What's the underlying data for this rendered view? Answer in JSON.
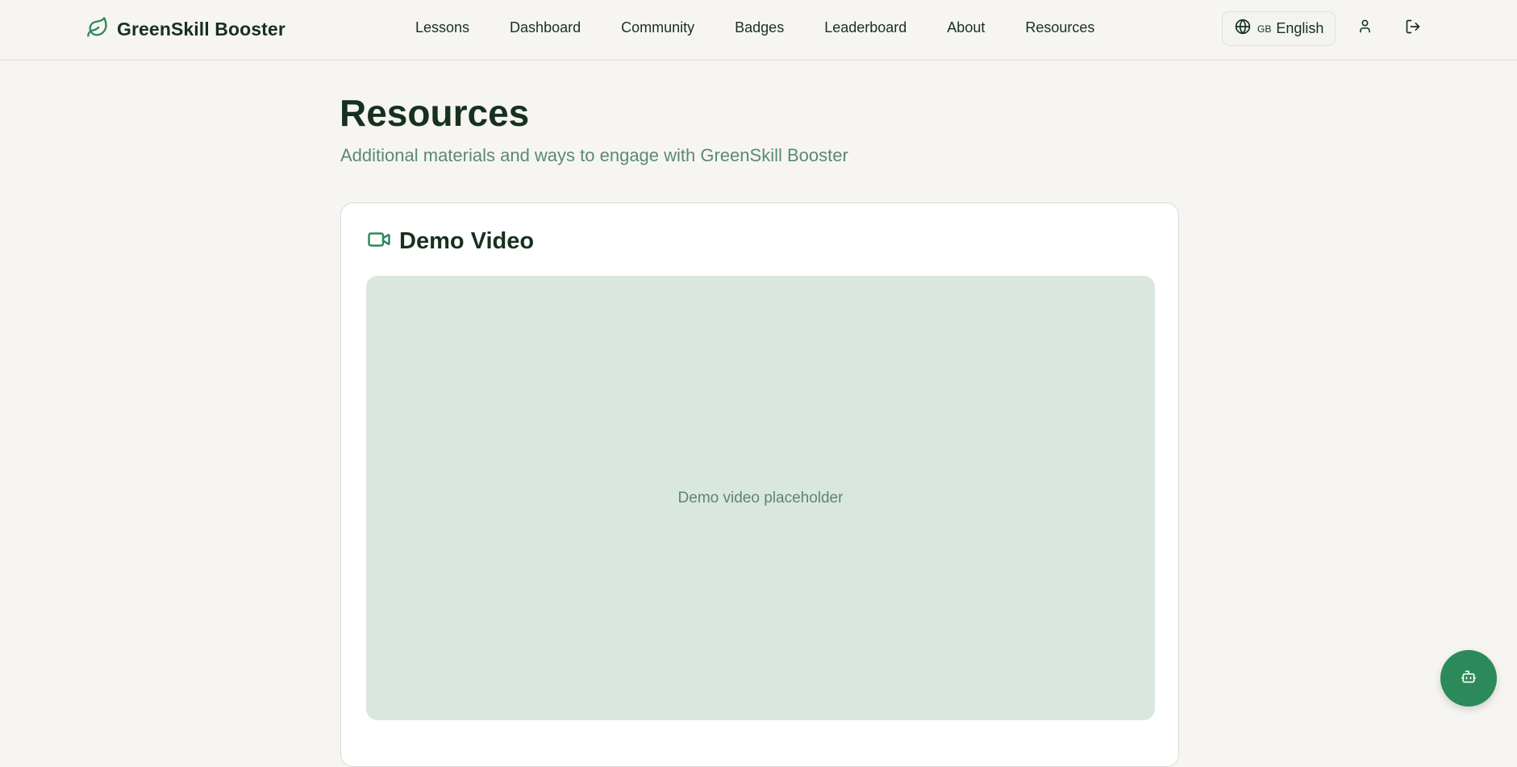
{
  "brand": {
    "name": "GreenSkill Booster",
    "icon": "leaf-icon",
    "color": "#2c8a5a"
  },
  "nav": {
    "items": [
      "Lessons",
      "Dashboard",
      "Community",
      "Badges",
      "Leaderboard",
      "About",
      "Resources"
    ]
  },
  "language": {
    "icon": "globe-icon",
    "code": "GB",
    "label": "English"
  },
  "header_actions": {
    "profile_icon": "user-icon",
    "logout_icon": "logout-icon"
  },
  "page": {
    "title": "Resources",
    "subtitle": "Additional materials and ways to engage with GreenSkill Booster"
  },
  "demo_section": {
    "icon": "video-camera-icon",
    "title": "Demo Video",
    "placeholder": "Demo video placeholder"
  },
  "assistant_button": {
    "icon": "bot-icon"
  },
  "colors": {
    "background": "#f6f5f2",
    "accent": "#2c8a5a",
    "text": "#17301f",
    "muted": "#5a8a72",
    "video_bg": "#d9e7de"
  }
}
